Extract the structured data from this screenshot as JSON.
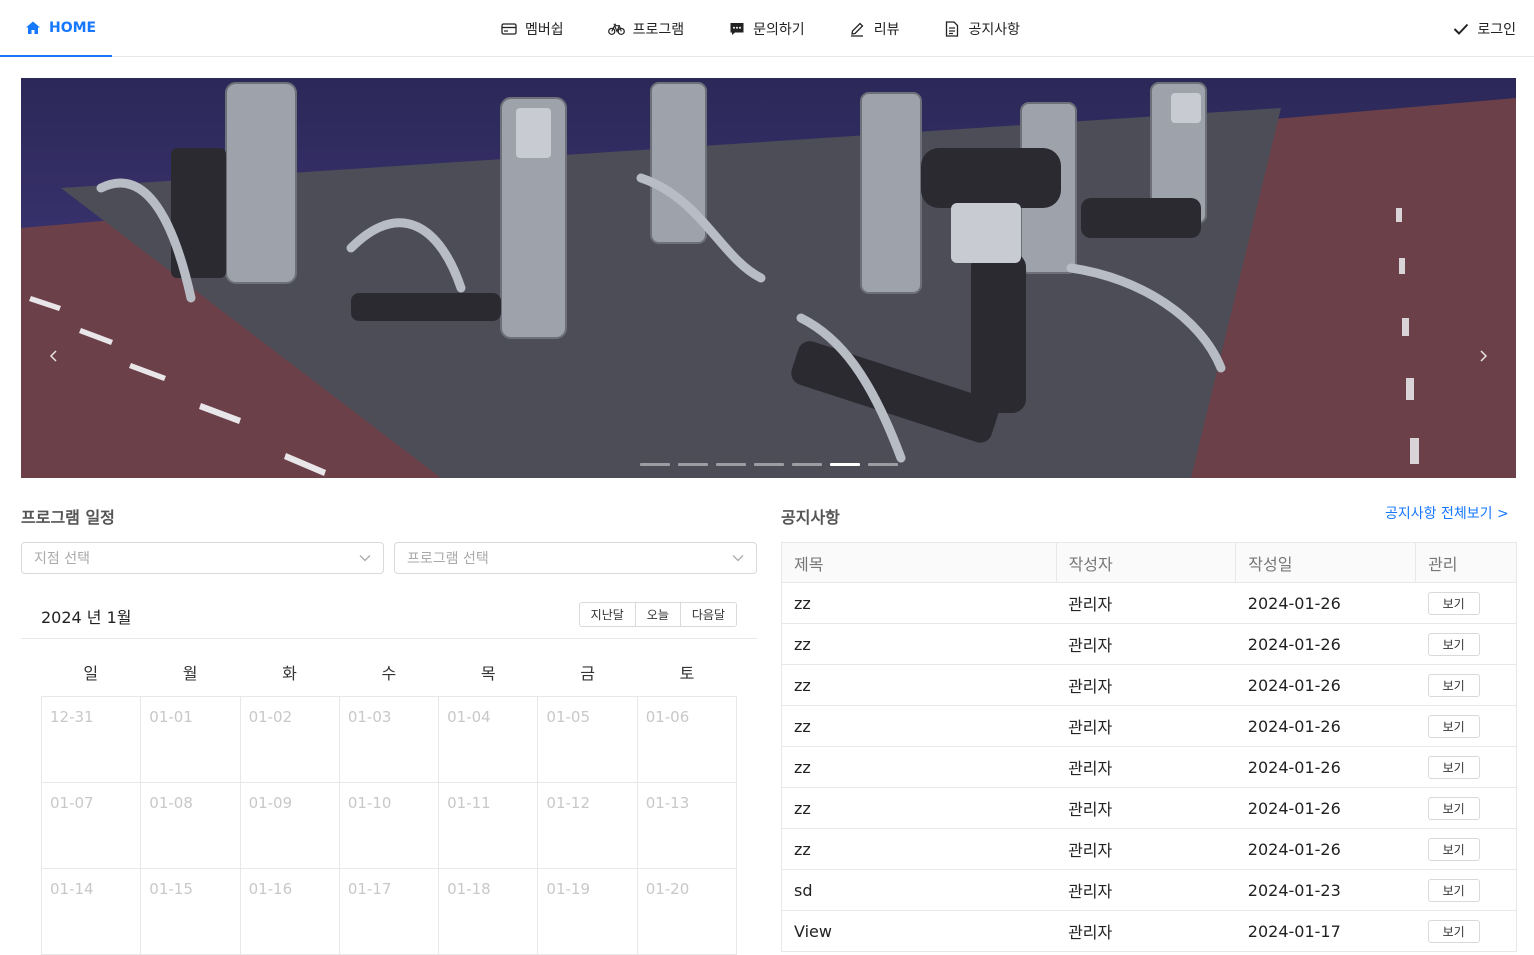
{
  "nav": {
    "home": "HOME",
    "items": [
      {
        "label": "멤버쉽",
        "icon": "card-icon"
      },
      {
        "label": "프로그램",
        "icon": "bicycle-icon"
      },
      {
        "label": "문의하기",
        "icon": "chat-icon"
      },
      {
        "label": "리뷰",
        "icon": "pencil-icon"
      },
      {
        "label": "공지사항",
        "icon": "document-icon"
      }
    ],
    "login": "로그인"
  },
  "carousel": {
    "slide_count": 7,
    "active_index": 5
  },
  "schedule": {
    "title": "프로그램 일정",
    "branch_placeholder": "지점 선택",
    "program_placeholder": "프로그램 선택",
    "month_label": "2024 년 1월",
    "prev": "지난달",
    "today": "오늘",
    "next": "다음달",
    "weekdays": [
      "일",
      "월",
      "화",
      "수",
      "목",
      "금",
      "토"
    ],
    "weeks": [
      [
        "12-31",
        "01-01",
        "01-02",
        "01-03",
        "01-04",
        "01-05",
        "01-06"
      ],
      [
        "01-07",
        "01-08",
        "01-09",
        "01-10",
        "01-11",
        "01-12",
        "01-13"
      ],
      [
        "01-14",
        "01-15",
        "01-16",
        "01-17",
        "01-18",
        "01-19",
        "01-20"
      ]
    ]
  },
  "notices": {
    "title": "공지사항",
    "view_all": "공지사항 전체보기 >",
    "columns": [
      "제목",
      "작성자",
      "작성일",
      "관리"
    ],
    "view_label": "보기",
    "rows": [
      {
        "title": "zz",
        "author": "관리자",
        "date": "2024-01-26"
      },
      {
        "title": "zz",
        "author": "관리자",
        "date": "2024-01-26"
      },
      {
        "title": "zz",
        "author": "관리자",
        "date": "2024-01-26"
      },
      {
        "title": "zz",
        "author": "관리자",
        "date": "2024-01-26"
      },
      {
        "title": "zz",
        "author": "관리자",
        "date": "2024-01-26"
      },
      {
        "title": "zz",
        "author": "관리자",
        "date": "2024-01-26"
      },
      {
        "title": "zz",
        "author": "관리자",
        "date": "2024-01-26"
      },
      {
        "title": "sd",
        "author": "관리자",
        "date": "2024-01-23"
      },
      {
        "title": "View",
        "author": "관리자",
        "date": "2024-01-17"
      }
    ]
  },
  "colors": {
    "accent": "#1677ff",
    "border": "#e8e8e8"
  }
}
